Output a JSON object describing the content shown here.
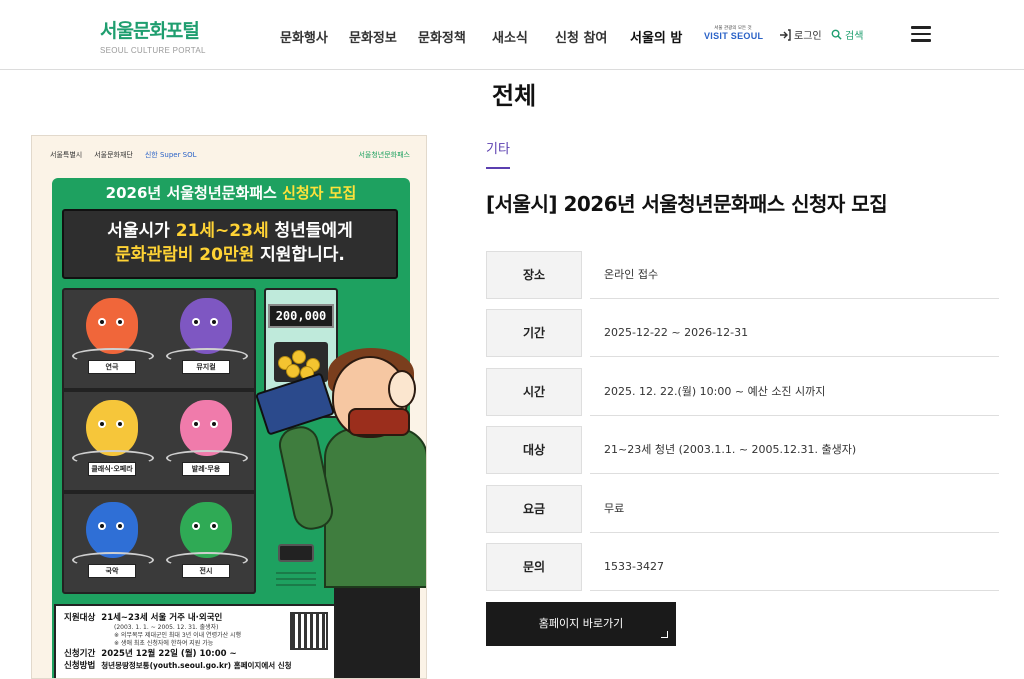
{
  "header": {
    "logo_main": "서울문화포털",
    "logo_sub": "SEOUL CULTURE PORTAL",
    "nav": [
      "문화행사",
      "문화정보",
      "문화정책",
      "새소식",
      "신청 참여",
      "서울의 밤"
    ],
    "visit_small": "서울 관광의 모든 것",
    "visit_big": "VISIT SEOUL",
    "login_label": "로그인",
    "search_label": "검색"
  },
  "page": {
    "title": "전체"
  },
  "poster": {
    "logo_city": "서울특별시",
    "logo_found": "서울문화재단",
    "logo_bank": "신한 Super SOL",
    "logo_pass": "서울청년문화패스",
    "banner_pre": "2026년 서울청년문화패스 ",
    "banner_hl": "신청자 모집",
    "screen_l1_pre": "서울시가 ",
    "screen_l1_hl": "21세~23세",
    "screen_l1_post": " 청년들에게",
    "screen_l2_hl": "문화관람비 20만원",
    "screen_l2_post": " 지원합니다.",
    "counter": "200,000",
    "items": [
      "연극",
      "뮤지컬",
      "클래식·오페라",
      "발레·무용",
      "국악",
      "전시"
    ],
    "target_label": "지원대상",
    "target_value": "21세~23세 서울 거주 내·외국인",
    "target_sub1": "(2003. 1. 1. ~ 2005. 12. 31. 출생자)",
    "target_sub2": "※ 의무복무 제대군인 최대 3년 이내 연령가산 시행",
    "target_sub3": "※ 생애 최초 신청자에 한하여 지원 가능",
    "period_label": "신청기간",
    "period_value": "2025년 12월 22일 (월) 10:00 ~",
    "method_label": "신청방법",
    "method_value": "청년몽땅정보통(youth.seoul.go.kr) 홈페이지에서 신청"
  },
  "detail": {
    "category": "기타",
    "title": "[서울시] 2026년 서울청년문화패스 신청자 모집",
    "rows": [
      {
        "label": "장소",
        "value": "온라인 접수"
      },
      {
        "label": "기간",
        "value": "2025-12-22 ~ 2026-12-31"
      },
      {
        "label": "시간",
        "value": "2025. 12. 22.(월) 10:00 ~ 예산 소진 시까지"
      },
      {
        "label": "대상",
        "value": "21~23세 청년 (2003.1.1. ~ 2005.12.31. 출생자)"
      },
      {
        "label": "요금",
        "value": "무료"
      },
      {
        "label": "문의",
        "value": "1533-3427"
      }
    ],
    "homepage_button": "홈페이지 바로가기"
  },
  "colors": {
    "brand_green": "#1f9e6f",
    "category_purple": "#5b3fb0",
    "button_dark": "#1a1a1a"
  },
  "icons": [
    "login-arrow-icon",
    "search-icon",
    "hamburger-menu-icon",
    "corner-arrow-icon"
  ]
}
